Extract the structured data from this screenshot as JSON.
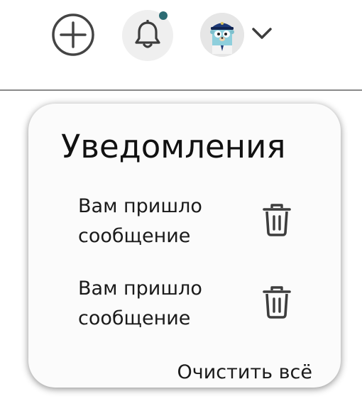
{
  "header": {
    "add_icon": "plus-circle-icon",
    "bell_icon": "bell-icon",
    "has_unread": true,
    "accent_color": "#2c6b73",
    "avatar_icon": "gopher-avatar",
    "dropdown_icon": "chevron-down-icon"
  },
  "notifications_panel": {
    "title": "Уведомления",
    "items": [
      {
        "line1": "Вам пришло",
        "line2": "сообщение",
        "delete_icon": "trash-icon"
      },
      {
        "line1": "Вам пришло",
        "line2": "сообщение",
        "delete_icon": "trash-icon"
      }
    ],
    "clear_all_label": "Очистить всё"
  }
}
